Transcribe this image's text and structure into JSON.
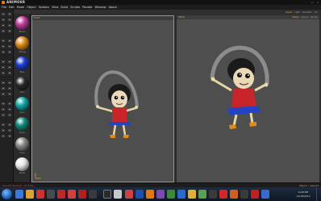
{
  "app": {
    "title": "ANIMO8R",
    "window_buttons": [
      "minimize-icon",
      "maximize-icon",
      "close-icon"
    ]
  },
  "menubar": {
    "items": [
      "File",
      "Edit",
      "Mode",
      "Object",
      "Options",
      "View",
      "Build",
      "Scripts",
      "Render",
      "Window",
      "About"
    ]
  },
  "toolbar_strip": {
    "tabs": [
      "Object",
      "Light",
      "Geometry",
      "Pro"
    ]
  },
  "materials": [
    {
      "label": "Bluish",
      "color": "#c23c9e"
    },
    {
      "label": "Orange",
      "color": "#e08a18"
    },
    {
      "label": "Blue",
      "color": "#1e3fd0"
    },
    {
      "label": "Red",
      "color": "#2a2a2a"
    },
    {
      "label": "Cyan",
      "color": "#12a8a8"
    },
    {
      "label": "Green",
      "color": "#0f8a7a"
    },
    {
      "label": "Grey",
      "color": "#8a8a8a"
    },
    {
      "label": "White",
      "color": "#e8e8e8"
    }
  ],
  "viewports": {
    "left_label": "Front",
    "right_label": "Other",
    "right_tools": [
      "Object",
      "Aspect",
      "Render"
    ]
  },
  "status": {
    "left": "Smooth Shaded - 47.6 fps",
    "right": "Object : object3"
  },
  "taskbar": {
    "time": "6:28 PM",
    "date": "12/18/2013"
  }
}
